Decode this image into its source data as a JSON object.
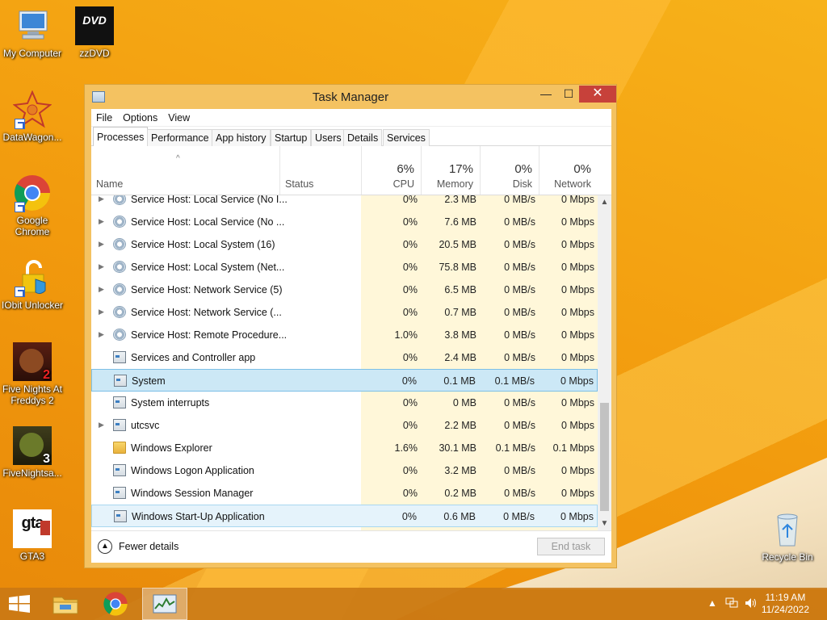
{
  "desktop": {
    "icons": [
      {
        "label": "My Computer"
      },
      {
        "label": "zzDVD",
        "badge": "DVD"
      },
      {
        "label": "DataWagon..."
      },
      {
        "label": "Google Chrome"
      },
      {
        "label": "IObit Unlocker"
      },
      {
        "label": "Five Nights At Freddys 2",
        "badge": "2"
      },
      {
        "label": "FiveNightsa...",
        "badge": "3"
      },
      {
        "label": "GTA3",
        "badge": "gta"
      },
      {
        "label": "Recycle Bin"
      }
    ]
  },
  "window": {
    "title": "Task Manager",
    "controls": {
      "minimize": "—",
      "maximize": "☐",
      "close": "✕"
    },
    "menu": [
      "File",
      "Options",
      "View"
    ],
    "tabs": [
      "Processes",
      "Performance",
      "App history",
      "Startup",
      "Users",
      "Details",
      "Services"
    ],
    "active_tab": "Processes",
    "columns": {
      "name": "Name",
      "status": "Status",
      "cpu": {
        "pct": "6%",
        "label": "CPU"
      },
      "memory": {
        "pct": "17%",
        "label": "Memory"
      },
      "disk": {
        "pct": "0%",
        "label": "Disk"
      },
      "network": {
        "pct": "0%",
        "label": "Network"
      }
    },
    "sort_indicator": "^",
    "rows": [
      {
        "name": "Service Host: Local Service (No I...",
        "cpu": "0%",
        "memory": "2.3 MB",
        "disk": "0 MB/s",
        "network": "0 Mbps",
        "icon": "gear",
        "expand": true
      },
      {
        "name": "Service Host: Local Service (No ...",
        "cpu": "0%",
        "memory": "7.6 MB",
        "disk": "0 MB/s",
        "network": "0 Mbps",
        "icon": "gear",
        "expand": true
      },
      {
        "name": "Service Host: Local System (16)",
        "cpu": "0%",
        "memory": "20.5 MB",
        "disk": "0 MB/s",
        "network": "0 Mbps",
        "icon": "gear",
        "expand": true
      },
      {
        "name": "Service Host: Local System (Net...",
        "cpu": "0%",
        "memory": "75.8 MB",
        "disk": "0 MB/s",
        "network": "0 Mbps",
        "icon": "gear",
        "expand": true
      },
      {
        "name": "Service Host: Network Service (5)",
        "cpu": "0%",
        "memory": "6.5 MB",
        "disk": "0 MB/s",
        "network": "0 Mbps",
        "icon": "gear",
        "expand": true
      },
      {
        "name": "Service Host: Network Service (...",
        "cpu": "0%",
        "memory": "0.7 MB",
        "disk": "0 MB/s",
        "network": "0 Mbps",
        "icon": "gear",
        "expand": true
      },
      {
        "name": "Service Host: Remote Procedure...",
        "cpu": "1.0%",
        "memory": "3.8 MB",
        "disk": "0 MB/s",
        "network": "0 Mbps",
        "icon": "gear",
        "expand": true
      },
      {
        "name": "Services and Controller app",
        "cpu": "0%",
        "memory": "2.4 MB",
        "disk": "0 MB/s",
        "network": "0 Mbps",
        "icon": "app",
        "expand": false
      },
      {
        "name": "System",
        "cpu": "0%",
        "memory": "0.1 MB",
        "disk": "0.1 MB/s",
        "network": "0 Mbps",
        "icon": "app",
        "expand": false,
        "state": "selected"
      },
      {
        "name": "System interrupts",
        "cpu": "0%",
        "memory": "0 MB",
        "disk": "0 MB/s",
        "network": "0 Mbps",
        "icon": "app",
        "expand": false
      },
      {
        "name": "utcsvc",
        "cpu": "0%",
        "memory": "2.2 MB",
        "disk": "0 MB/s",
        "network": "0 Mbps",
        "icon": "app",
        "expand": true
      },
      {
        "name": "Windows Explorer",
        "cpu": "1.6%",
        "memory": "30.1 MB",
        "disk": "0.1 MB/s",
        "network": "0.1 Mbps",
        "icon": "folder",
        "expand": false
      },
      {
        "name": "Windows Logon Application",
        "cpu": "0%",
        "memory": "3.2 MB",
        "disk": "0 MB/s",
        "network": "0 Mbps",
        "icon": "app",
        "expand": false
      },
      {
        "name": "Windows Session Manager",
        "cpu": "0%",
        "memory": "0.2 MB",
        "disk": "0 MB/s",
        "network": "0 Mbps",
        "icon": "app",
        "expand": false
      },
      {
        "name": "Windows Start-Up Application",
        "cpu": "0%",
        "memory": "0.6 MB",
        "disk": "0 MB/s",
        "network": "0 Mbps",
        "icon": "app",
        "expand": false,
        "state": "hover"
      }
    ],
    "footer": {
      "fewer_details": "Fewer details",
      "end_task": "End task"
    }
  },
  "taskbar": {
    "clock_time": "11:19 AM",
    "clock_date": "11/24/2022",
    "tray_expand": "▲",
    "tray_icons": [
      "network-icon",
      "volume-icon"
    ],
    "pinned": [
      "start-button",
      "file-explorer",
      "google-chrome",
      "task-manager"
    ]
  }
}
